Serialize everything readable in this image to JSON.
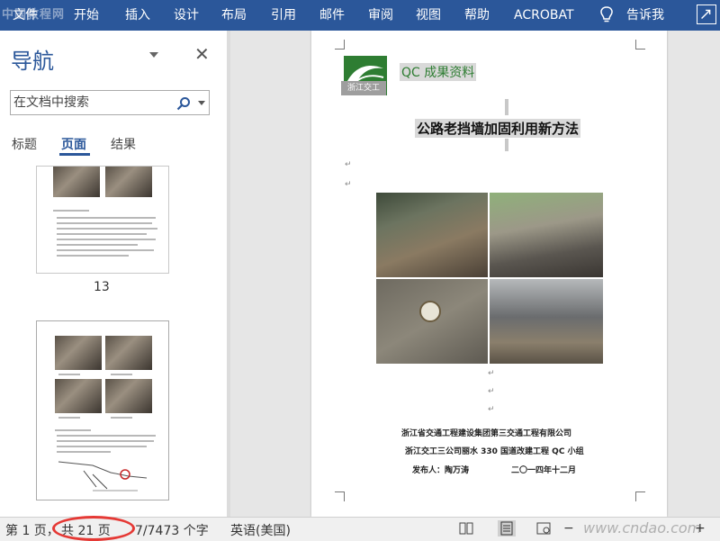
{
  "watermark": "中国教程网",
  "ribbon": {
    "tabs": [
      "文件",
      "开始",
      "插入",
      "设计",
      "布局",
      "引用",
      "邮件",
      "审阅",
      "视图",
      "帮助",
      "ACROBAT"
    ],
    "tell_me": "告诉我"
  },
  "nav_pane": {
    "title": "导航",
    "close_glyph": "✕",
    "search_placeholder": "在文档中搜索",
    "tabs": {
      "headings": "标题",
      "pages": "页面",
      "results": "结果"
    },
    "thumbnail_page_number": "13"
  },
  "document": {
    "qc_label": "QC 成果资料",
    "logo_text": "浙江交工",
    "title": "公路老挡墙加固利用新方法",
    "para_mark": "↵",
    "footer_lines": [
      "浙江省交通工程建设集团第三交通工程有限公司",
      "浙江交工三公司丽水 330 国道改建工程 QC 小组",
      "发布人：陶万涛",
      "二〇一四年十二月"
    ]
  },
  "status_bar": {
    "page": "第 1 页，",
    "total": "共 21 页",
    "words": "7/7473 个字",
    "language": "英语(美国)",
    "zoom_out": "−",
    "zoom_in": "+"
  },
  "site_watermark": "www.cndao.com"
}
